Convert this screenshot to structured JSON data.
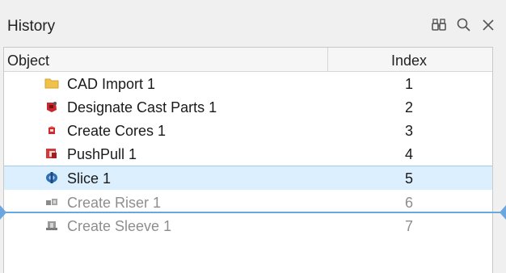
{
  "panel": {
    "title": "History",
    "icons": [
      "binoculars-icon",
      "search-icon",
      "close-icon"
    ]
  },
  "columns": {
    "object": "Object",
    "index": "Index"
  },
  "rows": [
    {
      "label": "CAD Import 1",
      "index": "1",
      "icon": "folder-icon",
      "state": "normal"
    },
    {
      "label": "Designate Cast Parts 1",
      "index": "2",
      "icon": "cast-parts-icon",
      "state": "normal"
    },
    {
      "label": "Create Cores 1",
      "index": "3",
      "icon": "cores-icon",
      "state": "normal"
    },
    {
      "label": "PushPull 1",
      "index": "4",
      "icon": "pushpull-icon",
      "state": "normal"
    },
    {
      "label": "Slice 1",
      "index": "5",
      "icon": "slice-icon",
      "state": "selected"
    },
    {
      "label": "Create Riser 1",
      "index": "6",
      "icon": "riser-icon",
      "state": "suppressed"
    },
    {
      "label": "Create Sleeve 1",
      "index": "7",
      "icon": "sleeve-icon",
      "state": "suppressed"
    }
  ],
  "colors": {
    "selected_row": "#dcefff",
    "history_marker": "#6aa7e0",
    "suppressed_text": "#8e8e8e"
  }
}
